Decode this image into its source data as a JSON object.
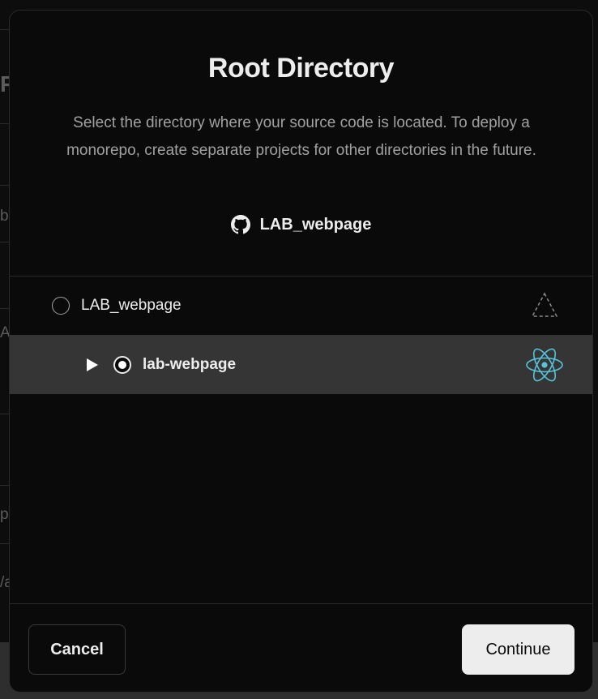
{
  "modal": {
    "title": "Root Directory",
    "description": "Select the directory where your source code is located. To deploy a monorepo, create separate projects for other directories in the future.",
    "repository": {
      "icon": "github-icon",
      "name": "LAB_webpage"
    }
  },
  "tree": {
    "items": [
      {
        "label": "LAB_webpage",
        "selected": false,
        "framework_icon": "other-framework-triangle-icon"
      },
      {
        "label": "lab-webpage",
        "selected": true,
        "expander_icon": "play-triangle-icon",
        "framework_icon": "react-icon"
      }
    ]
  },
  "footer": {
    "cancel_label": "Cancel",
    "continue_label": "Continue"
  },
  "colors": {
    "background": "#0a0a0a",
    "selected_row": "#353535",
    "primary_button": "#ededed",
    "react": "#58c4dc",
    "muted_text": "#a1a1a1"
  }
}
